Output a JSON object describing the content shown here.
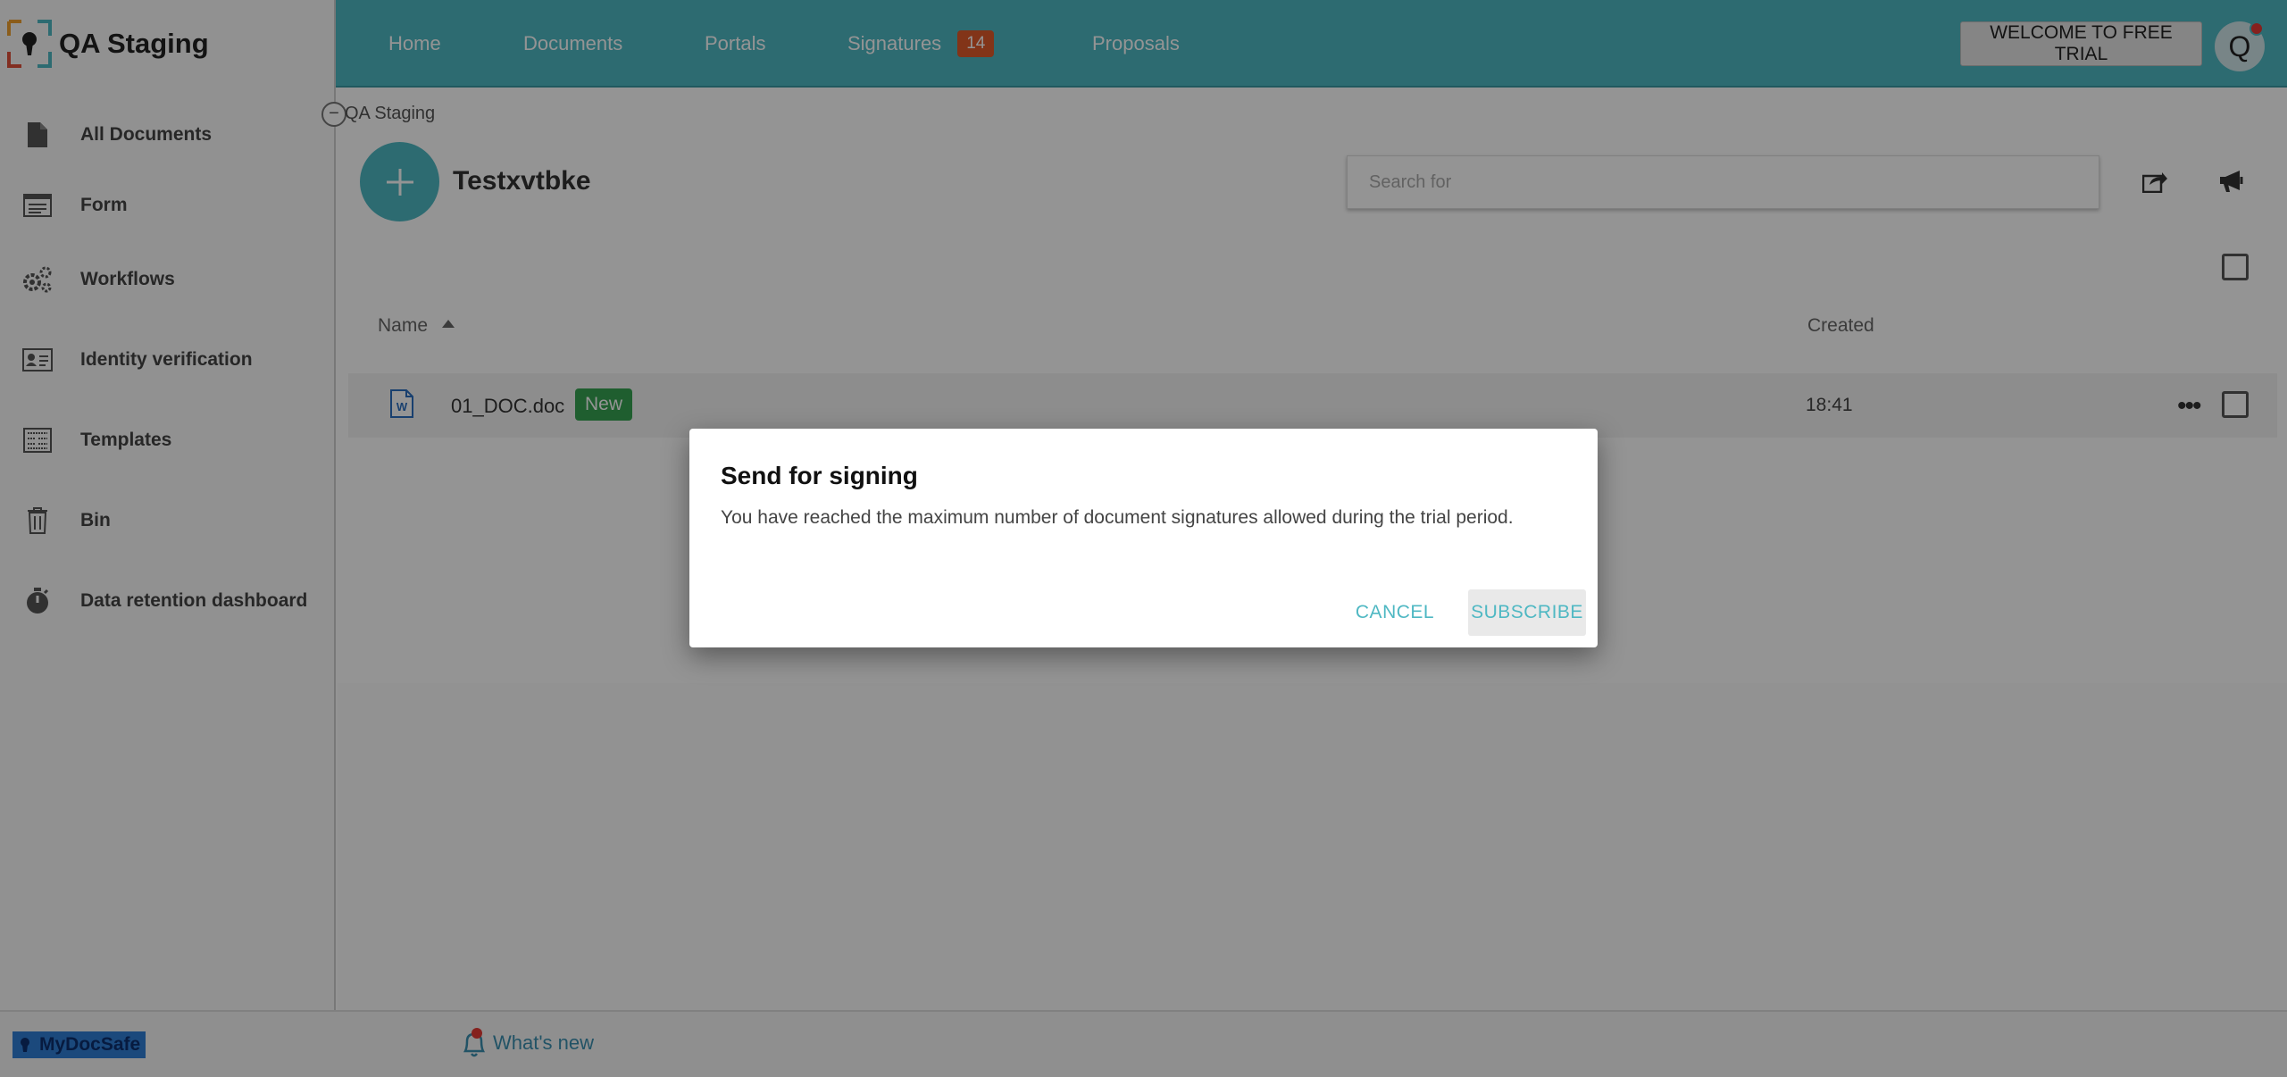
{
  "app": {
    "name": "QA Staging"
  },
  "sidebar": {
    "items": [
      {
        "label": "All Documents",
        "icon": "document-icon"
      },
      {
        "label": "Form",
        "icon": "form-icon"
      },
      {
        "label": "Workflows",
        "icon": "gears-icon"
      },
      {
        "label": "Identity verification",
        "icon": "id-card-icon"
      },
      {
        "label": "Templates",
        "icon": "template-icon"
      },
      {
        "label": "Bin",
        "icon": "trash-icon"
      },
      {
        "label": "Data retention dashboard",
        "icon": "stopwatch-icon"
      }
    ]
  },
  "topnav": {
    "items": [
      {
        "label": "Home"
      },
      {
        "label": "Documents"
      },
      {
        "label": "Portals"
      },
      {
        "label": "Signatures",
        "badge": "14"
      },
      {
        "label": "Proposals"
      }
    ],
    "trial_button": "WELCOME TO FREE TRIAL",
    "avatar_letter": "Q"
  },
  "main": {
    "breadcrumb": "QA Staging",
    "folder_title": "Testxvtbke",
    "search_placeholder": "Search for",
    "columns": {
      "name": "Name",
      "created": "Created"
    },
    "rows": [
      {
        "name": "01_DOC.doc",
        "badge": "New",
        "created": "18:41"
      }
    ]
  },
  "footer": {
    "brand": "MyDocSafe",
    "whats_new": "What's new"
  },
  "modal": {
    "title": "Send for signing",
    "message": "You have reached the maximum number of document signatures allowed during the trial period.",
    "cancel_label": "CANCEL",
    "subscribe_label": "SUBSCRIBE"
  },
  "colors": {
    "accent": "#4fb8c3",
    "badge_orange": "#e05a2a",
    "badge_green": "#36a352"
  }
}
